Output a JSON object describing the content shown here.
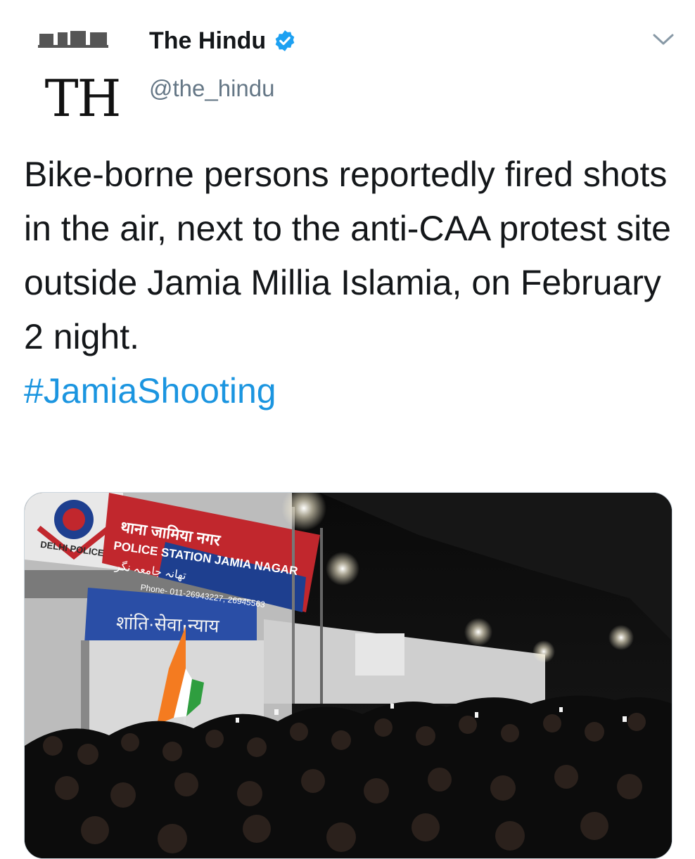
{
  "account": {
    "avatar_text": "TH",
    "display_name": "The Hindu",
    "handle": "@the_hindu",
    "verified_icon": "verified-badge-icon",
    "menu_icon": "chevron-down-icon"
  },
  "tweet": {
    "text": "Bike-borne persons reportedly fired shots in the air, next to the anti-CAA protest site outside Jamia Millia Islamia, on February 2 night.",
    "hashtag": "#JamiaShooting"
  },
  "media": {
    "sign_hindi": "थाना जामिया नगर",
    "sign_english": "POLICE STATION JAMIA NAGAR",
    "sign_urdu": "تھانہ جامعہ نگر",
    "sign_phone": "Phone- 011-26943227, 26945563",
    "sign_delhi_police": "DELHI POLICE",
    "sign_motto": "शांति·सेवा·न्याय"
  },
  "colors": {
    "link": "#1b95e0",
    "verified": "#1da1f2",
    "handle": "#657786"
  }
}
